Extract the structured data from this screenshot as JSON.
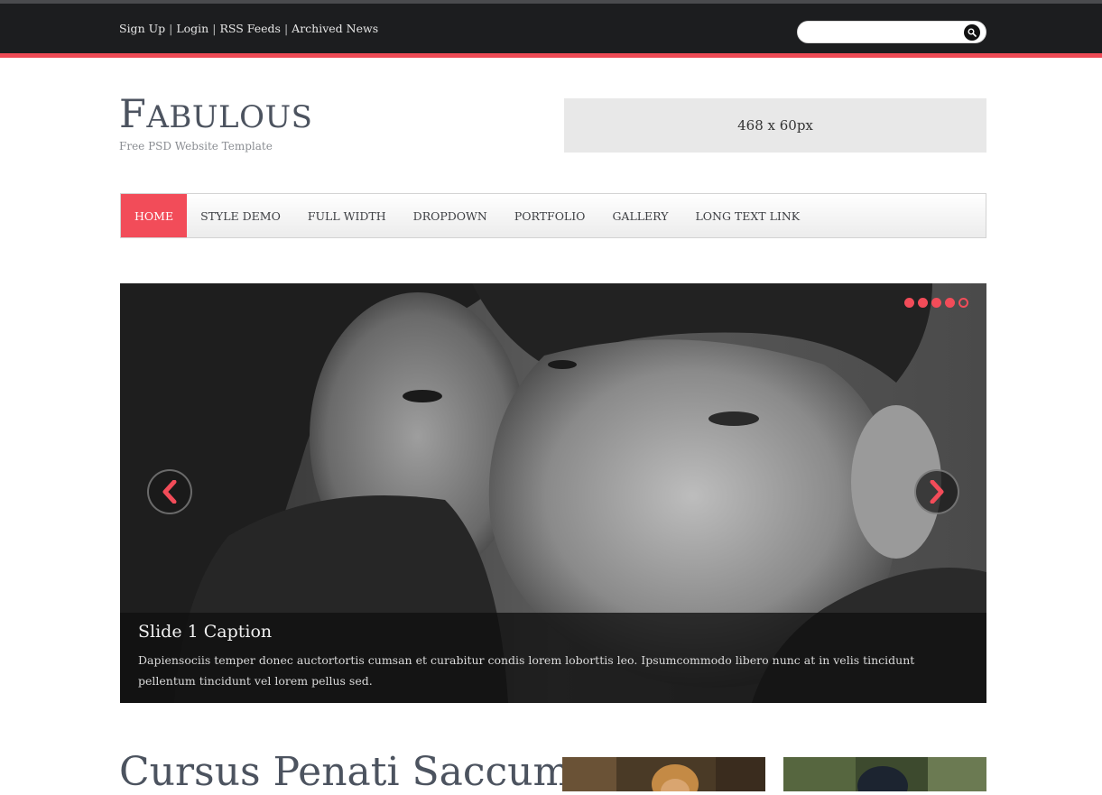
{
  "topbar": {
    "links": [
      "Sign Up",
      "Login",
      "RSS Feeds",
      "Archived News"
    ],
    "separator": "|",
    "search_placeholder": ""
  },
  "header": {
    "logo_first_letter": "F",
    "logo_rest": "ABULOUS",
    "tagline": "Free PSD Website Template",
    "ad_label": "468 x 60px"
  },
  "nav": {
    "items": [
      "HOME",
      "STYLE DEMO",
      "FULL WIDTH",
      "DROPDOWN",
      "PORTFOLIO",
      "GALLERY",
      "LONG TEXT LINK"
    ],
    "active_index": 0
  },
  "slider": {
    "caption_title": "Slide 1 Caption",
    "caption_text": "Dapiensociis temper donec auctortortis cumsan et curabitur condis lorem loborttis leo. Ipsumcommodo libero nunc at in velis tincidunt pellentum tincidunt vel lorem pellus sed.",
    "dot_count": 5,
    "active_dot": 4
  },
  "content": {
    "heading": "Cursus Penati Saccum"
  },
  "colors": {
    "accent": "#f24c59",
    "topbar": "#1c1d1f",
    "logo": "#4c535f"
  },
  "icons": {
    "search": "search-icon",
    "prev": "chevron-left-icon",
    "next": "chevron-right-icon"
  }
}
